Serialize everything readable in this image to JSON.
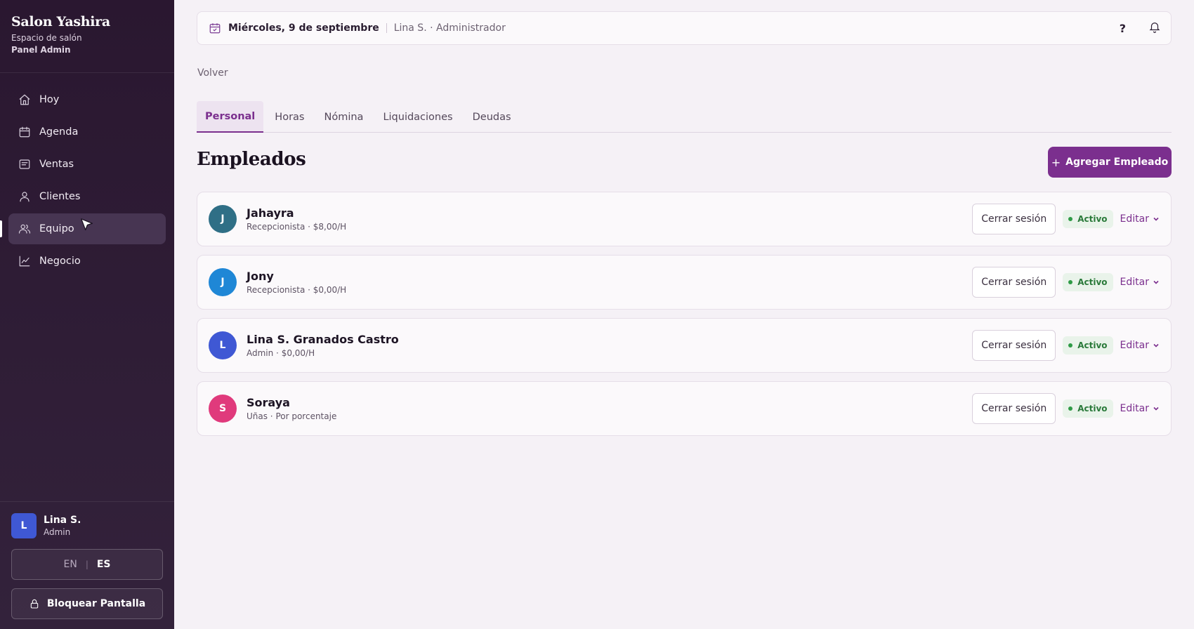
{
  "sidebar": {
    "brand_title": "Salon Yashira",
    "brand_sub": "Espacio de salón",
    "brand_panel": "Panel Admin",
    "items": [
      {
        "label": "Hoy",
        "icon": "home-icon"
      },
      {
        "label": "Agenda",
        "icon": "calendar-icon"
      },
      {
        "label": "Ventas",
        "icon": "receipt-icon"
      },
      {
        "label": "Clientes",
        "icon": "user-icon"
      },
      {
        "label": "Equipo",
        "icon": "users-icon",
        "active": true
      },
      {
        "label": "Negocio",
        "icon": "chart-line-icon"
      }
    ],
    "user": {
      "initial": "L",
      "name": "Lina S.",
      "role": "Admin"
    },
    "lang": {
      "en": "EN",
      "es": "ES",
      "selected": "ES"
    },
    "lock_label": "Bloquear Pantalla"
  },
  "topbar": {
    "date": "Miércoles, 9 de septiembre",
    "user": "Lina S. · Administrador",
    "help": "?"
  },
  "back_label": "Volver",
  "tabs": [
    {
      "label": "Personal",
      "active": true
    },
    {
      "label": "Horas"
    },
    {
      "label": "Nómina"
    },
    {
      "label": "Liquidaciones"
    },
    {
      "label": "Deudas"
    }
  ],
  "page_title": "Empleados",
  "add_button": {
    "plus": "+",
    "label": "Agregar Empleado"
  },
  "employees": [
    {
      "initial": "J",
      "name": "Jahayra",
      "sub": "Recepcionista · $8,00/H",
      "color": "#2f6f86",
      "logout": "Cerrar sesión",
      "status": "Activo",
      "edit": "Editar"
    },
    {
      "initial": "J",
      "name": "Jony",
      "sub": "Recepcionista · $0,00/H",
      "color": "#1f87d6",
      "logout": "Cerrar sesión",
      "status": "Activo",
      "edit": "Editar"
    },
    {
      "initial": "L",
      "name": "Lina S. Granados Castro",
      "sub": "Admin · $0,00/H",
      "color": "#3f58d4",
      "logout": "Cerrar sesión",
      "status": "Activo",
      "edit": "Editar"
    },
    {
      "initial": "S",
      "name": "Soraya",
      "sub": "Uñas · Por porcentaje",
      "color": "#e03a7c",
      "logout": "Cerrar sesión",
      "status": "Activo",
      "edit": "Editar"
    }
  ],
  "colors": {
    "accent": "#7b2f8e",
    "sidebar_bg": "#2e1c35",
    "status_green": "#2a7a3a"
  }
}
